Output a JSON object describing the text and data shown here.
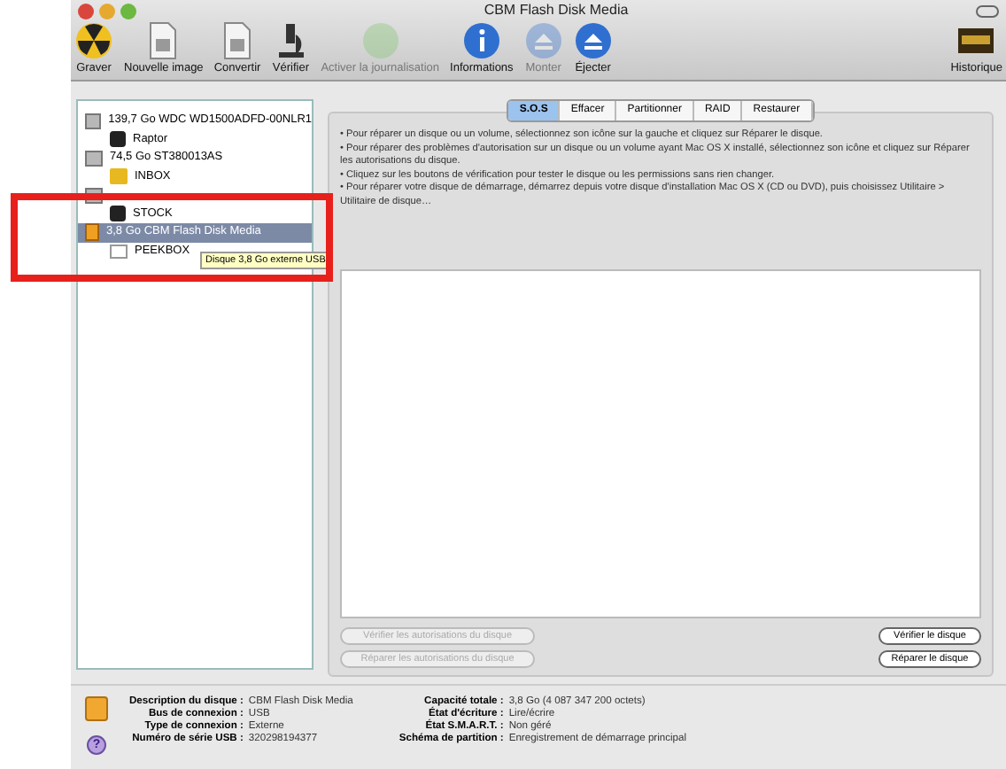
{
  "window": {
    "title": "CBM Flash Disk Media"
  },
  "toolbar": [
    {
      "label": "Graver",
      "kind": "burn",
      "disabled": false
    },
    {
      "label": "Nouvelle image",
      "kind": "doc",
      "disabled": false
    },
    {
      "label": "Convertir",
      "kind": "doc",
      "disabled": false
    },
    {
      "label": "Vérifier",
      "kind": "scope",
      "disabled": false
    },
    {
      "label": "Activer la journalisation",
      "kind": "round",
      "disabled": true
    },
    {
      "label": "Informations",
      "kind": "info",
      "disabled": false
    },
    {
      "label": "Monter",
      "kind": "arrow",
      "disabled": true
    },
    {
      "label": "Éjecter",
      "kind": "arrow",
      "disabled": false
    },
    {
      "label": "Historique",
      "kind": "log",
      "disabled": false
    }
  ],
  "sidebar": {
    "items": [
      {
        "label": "139,7 Go WDC WD1500ADFD-00NLR1",
        "kind": "disk",
        "selected": false,
        "children": [
          {
            "label": "Raptor",
            "kind": "volume",
            "selected": false
          }
        ]
      },
      {
        "label": "74,5 Go ST380013AS",
        "kind": "disk",
        "selected": false,
        "children": [
          {
            "label": "INBOX",
            "kind": "folder",
            "selected": false
          }
        ]
      },
      {
        "kind": "disk",
        "selected": false,
        "children": [
          {
            "label": "STOCK",
            "kind": "volume",
            "selected": false
          }
        ]
      },
      {
        "label": "3,8 Go CBM Flash Disk Media",
        "kind": "usb",
        "selected": true,
        "children": [
          {
            "label": "PEEKBOX",
            "kind": "blank",
            "selected": false
          }
        ]
      }
    ],
    "tooltip": "Disque 3,8 Go externe USB"
  },
  "tabs": [
    {
      "label": "S.O.S",
      "selected": true
    },
    {
      "label": "Effacer",
      "selected": false
    },
    {
      "label": "Partitionner",
      "selected": false
    },
    {
      "label": "RAID",
      "selected": false
    },
    {
      "label": "Restaurer",
      "selected": false
    }
  ],
  "instructions": [
    "• Pour réparer un disque ou un volume, sélectionnez son icône sur la gauche et cliquez sur Réparer le disque.",
    "• Pour réparer des problèmes d'autorisation sur un disque ou un volume ayant Mac OS X installé, sélectionnez son icône et cliquez sur Réparer les autorisations du disque.",
    "• Cliquez sur les boutons de vérification pour tester le disque ou les permissions sans rien changer.",
    "• Pour réparer votre disque de démarrage, démarrez depuis votre disque d'installation Mac OS X (CD ou DVD), puis choisissez Utilitaire > Utilitaire de disque…"
  ],
  "buttons_left": [
    {
      "label": "Vérifier les autorisations du disque",
      "disabled": true
    },
    {
      "label": "Réparer les autorisations du disque",
      "disabled": true
    }
  ],
  "buttons_right": [
    {
      "label": "Vérifier le disque",
      "disabled": false
    },
    {
      "label": "Réparer le disque",
      "disabled": false
    }
  ],
  "info_left": [
    {
      "label": "Description du disque :",
      "value": "CBM Flash Disk Media"
    },
    {
      "label": "Bus de connexion :",
      "value": "USB"
    },
    {
      "label": "Type de connexion :",
      "value": "Externe"
    },
    {
      "label": "Numéro de série USB :",
      "value": "320298194377"
    }
  ],
  "info_right": [
    {
      "label": "Capacité totale :",
      "value": "3,8 Go (4 087 347 200 octets)"
    },
    {
      "label": "État d'écriture :",
      "value": "Lire/écrire"
    },
    {
      "label": "État S.M.A.R.T. :",
      "value": "Non géré"
    },
    {
      "label": "Schéma de partition :",
      "value": "Enregistrement de démarrage principal"
    }
  ],
  "help": "?"
}
